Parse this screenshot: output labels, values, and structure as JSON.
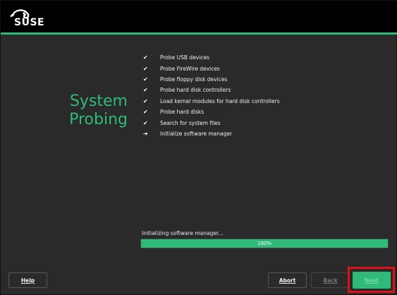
{
  "header": {
    "logo_text": "SUSE",
    "accent_color": "#30ba78"
  },
  "title": {
    "line1": "System",
    "line2": "Probing"
  },
  "steps": [
    {
      "mark": "✔",
      "label": "Probe USB devices"
    },
    {
      "mark": "✔",
      "label": "Probe FireWire devices"
    },
    {
      "mark": "✔",
      "label": "Probe floppy disk devices"
    },
    {
      "mark": "✔",
      "label": "Probe hard disk controllers"
    },
    {
      "mark": "✔",
      "label": "Load kernel modules for hard disk controllers"
    },
    {
      "mark": "✔",
      "label": "Probe hard disks"
    },
    {
      "mark": "✔",
      "label": "Search for system files"
    },
    {
      "mark": "➔",
      "label": "Initialize software manager"
    }
  ],
  "progress": {
    "label": "Initializing software manager...",
    "value_text": "100%",
    "value": 1.0
  },
  "buttons": {
    "help": "Help",
    "abort": "Abort",
    "back": "Back",
    "next": "Next"
  }
}
